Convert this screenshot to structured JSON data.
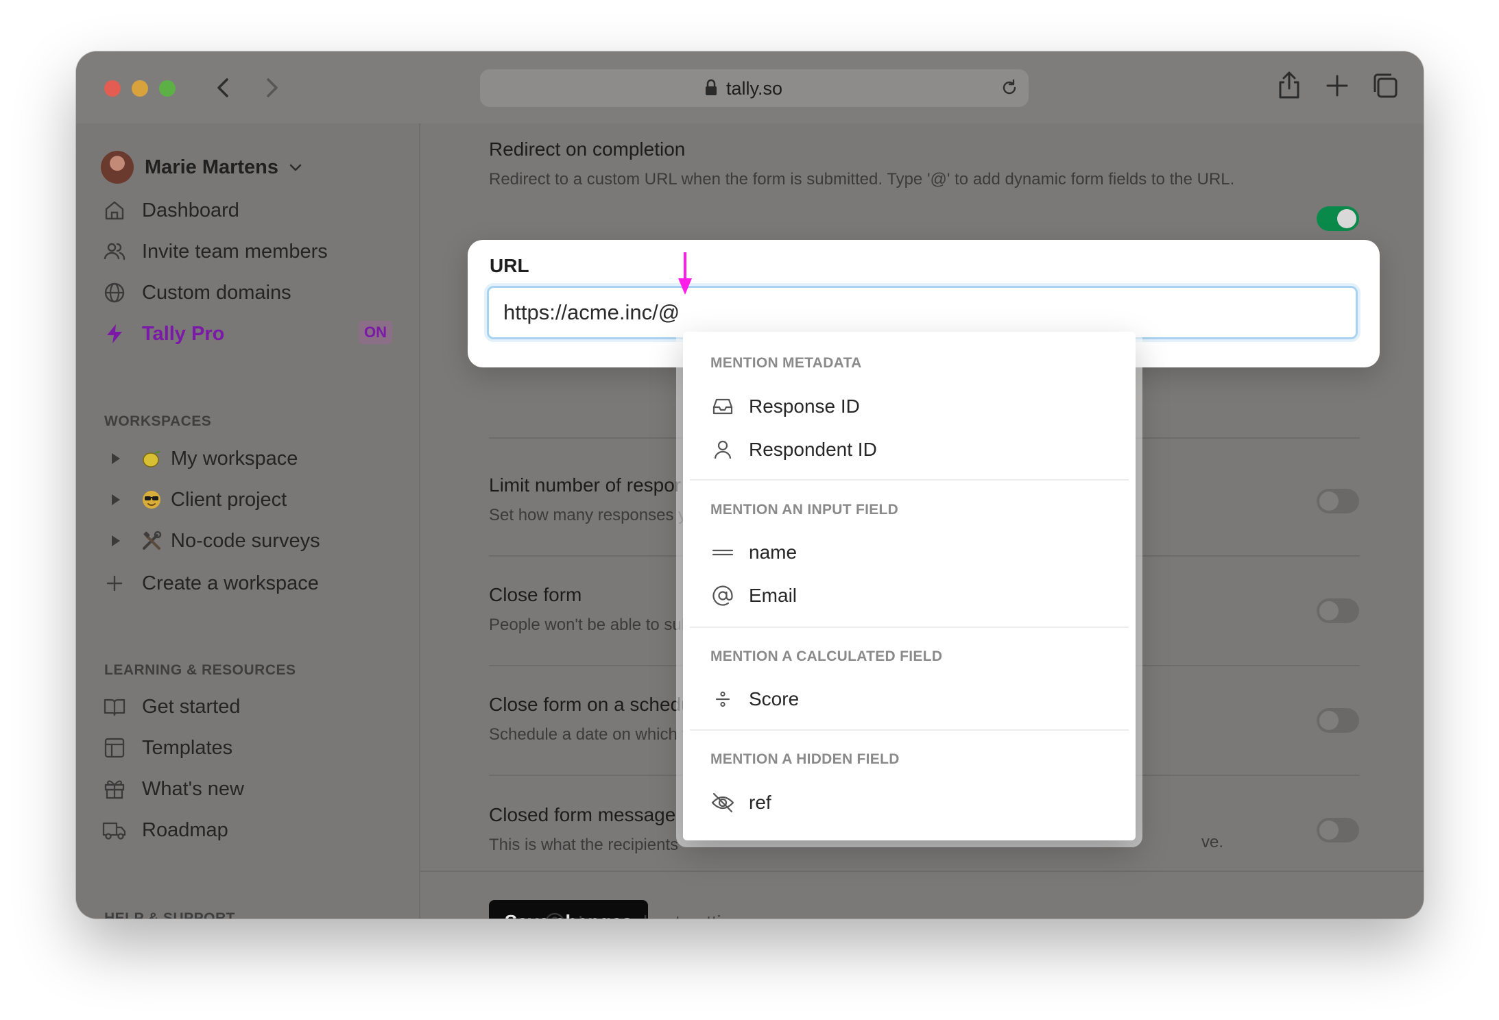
{
  "browser": {
    "address": "tally.so"
  },
  "sidebar": {
    "user_name": "Marie Martens",
    "nav": [
      {
        "label": "Dashboard",
        "icon": "home-icon"
      },
      {
        "label": "Invite team members",
        "icon": "users-icon"
      },
      {
        "label": "Custom domains",
        "icon": "globe-icon"
      },
      {
        "label": "Tally Pro",
        "icon": "lightning-icon",
        "badge": "ON"
      }
    ],
    "workspaces_heading": "WORKSPACES",
    "workspaces": [
      {
        "label": "My workspace",
        "emoji": "🍋"
      },
      {
        "label": "Client project",
        "emoji": "😎"
      },
      {
        "label": "No-code surveys",
        "emoji": "🛠"
      }
    ],
    "create_workspace": "Create a workspace",
    "learning_heading": "LEARNING & RESOURCES",
    "learning": [
      {
        "label": "Get started",
        "icon": "book-icon"
      },
      {
        "label": "Templates",
        "icon": "layout-icon"
      },
      {
        "label": "What's new",
        "icon": "gift-icon"
      },
      {
        "label": "Roadmap",
        "icon": "truck-icon"
      }
    ],
    "help_heading": "HELP & SUPPORT"
  },
  "main": {
    "redirect": {
      "title": "Redirect on completion",
      "desc": "Redirect to a custom URL when the form is submitted. Type '@' to add dynamic form fields to the URL.",
      "enabled": true
    },
    "url_field": {
      "label": "URL",
      "value": "https://acme.inc/@"
    },
    "settings": [
      {
        "title": "Limit number of respor",
        "desc": "Set how many responses y"
      },
      {
        "title": "Close form",
        "desc": "People won't be able to sub"
      },
      {
        "title": "Close form on a schedu",
        "desc": "Schedule a date on which t"
      },
      {
        "title": "Closed form message",
        "desc": "This is what the recipients",
        "desc_tail": "ve."
      }
    ],
    "save_label": "Save changes",
    "learn_label": "Learn about settings"
  },
  "mention_menu": {
    "sections": [
      {
        "heading": "MENTION METADATA",
        "items": [
          {
            "label": "Response ID",
            "icon": "inbox-icon"
          },
          {
            "label": "Respondent ID",
            "icon": "person-icon"
          }
        ]
      },
      {
        "heading": "MENTION AN INPUT FIELD",
        "items": [
          {
            "label": "name",
            "icon": "short-text-icon"
          },
          {
            "label": "Email",
            "icon": "at-sign-icon"
          }
        ]
      },
      {
        "heading": "MENTION A CALCULATED FIELD",
        "items": [
          {
            "label": "Score",
            "icon": "divide-icon"
          }
        ]
      },
      {
        "heading": "MENTION A HIDDEN FIELD",
        "items": [
          {
            "label": "ref",
            "icon": "eye-off-icon"
          }
        ]
      }
    ]
  },
  "colors": {
    "accent_pro": "#7a1aa6",
    "toggle_on": "#0a8a4a",
    "arrow": "#ff1ee8",
    "input_focus": "#a8d2ef"
  }
}
